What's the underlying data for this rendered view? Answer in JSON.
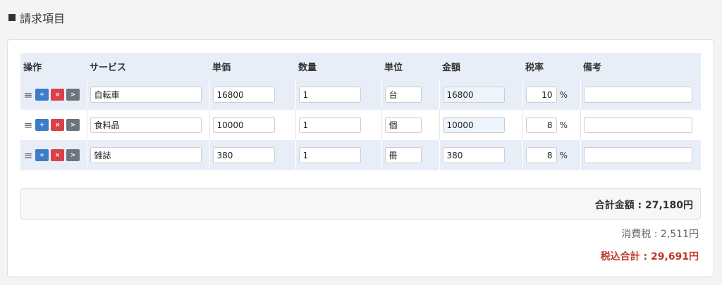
{
  "section": {
    "title": "請求項目"
  },
  "table": {
    "headers": {
      "ops": "操作",
      "service": "サービス",
      "unit_price": "単価",
      "quantity": "数量",
      "unit": "単位",
      "amount": "金額",
      "tax_rate": "税率",
      "notes": "備考"
    },
    "buttons": {
      "add": "+",
      "remove": "×",
      "move": ">"
    },
    "percent_sign": "%",
    "rows": [
      {
        "service": "自転車",
        "unit_price": "16800",
        "quantity": "1",
        "unit": "台",
        "amount": "16800",
        "tax_rate": "10",
        "notes": ""
      },
      {
        "service": "食料品",
        "unit_price": "10000",
        "quantity": "1",
        "unit": "個",
        "amount": "10000",
        "tax_rate": "8",
        "notes": ""
      },
      {
        "service": "雑誌",
        "unit_price": "380",
        "quantity": "1",
        "unit": "冊",
        "amount": "380",
        "tax_rate": "8",
        "notes": ""
      }
    ]
  },
  "totals": {
    "subtotal": "合計金額 : 27,180円",
    "tax": "消費税 : 2,511円",
    "grand_total": "税込合計 : 29,691円"
  },
  "colors": {
    "header_bg": "#e8eef8",
    "add_button": "#3d7cc9",
    "remove_button": "#d9404a",
    "move_button": "#6c757d",
    "grand_total_text": "#c0392b"
  },
  "icons": {
    "handle": "drag-handle-icon"
  }
}
